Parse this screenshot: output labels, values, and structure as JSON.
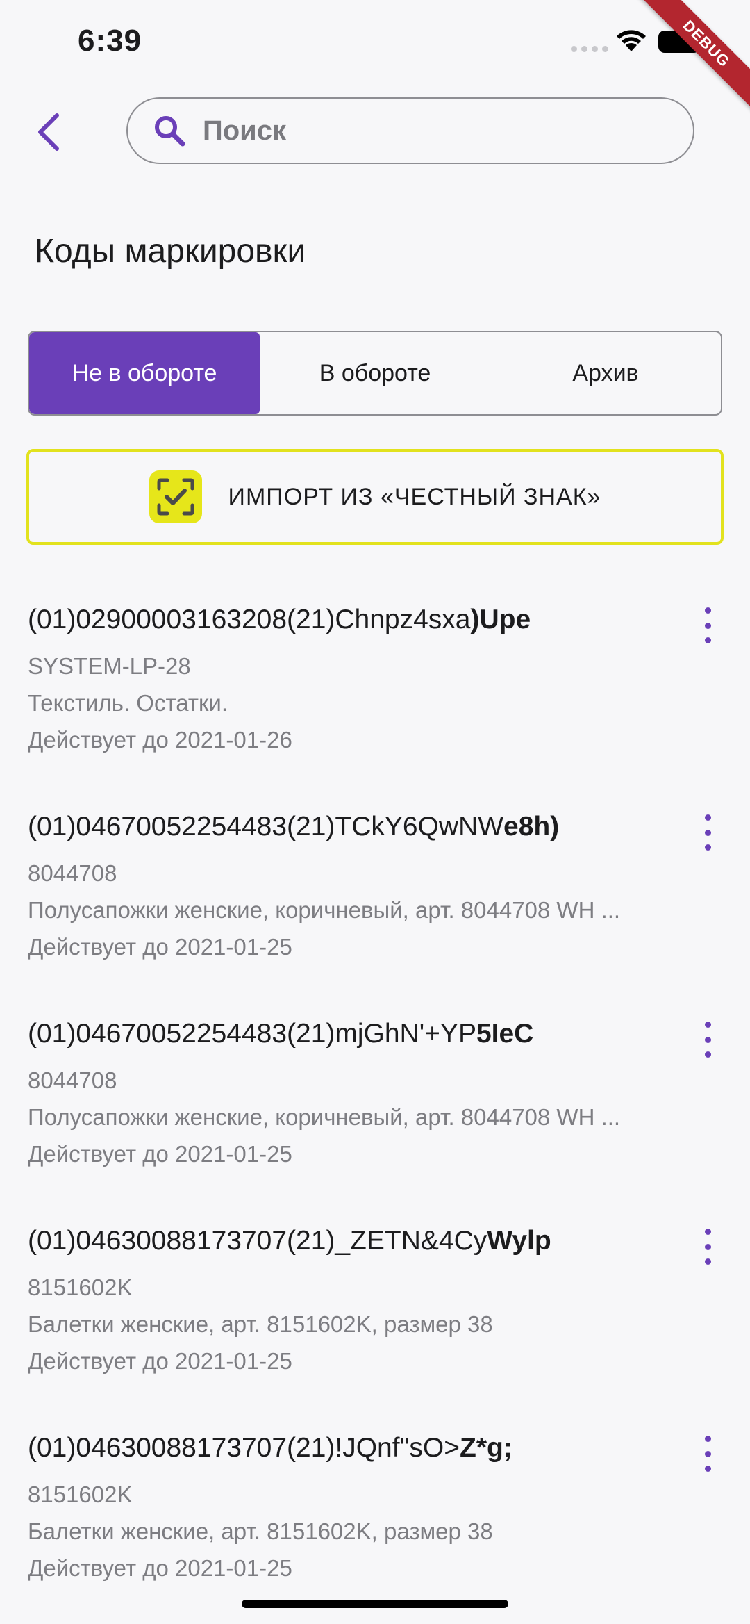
{
  "status_bar": {
    "time": "6:39"
  },
  "debug_banner": "DEBUG",
  "search": {
    "placeholder": "Поиск",
    "value": ""
  },
  "page_title": "Коды маркировки",
  "tabs": [
    {
      "label": "Не в обороте",
      "active": true
    },
    {
      "label": "В обороте",
      "active": false
    },
    {
      "label": "Архив",
      "active": false
    }
  ],
  "import_button": {
    "label": "ИМПОРТ ИЗ «ЧЕСТНЫЙ ЗНАК»",
    "icon": "honest-sign-check-icon"
  },
  "items": [
    {
      "code_prefix": "(01)02900003163208(21)Chnpz4sxa",
      "code_suffix": ")Upe",
      "sku": "SYSTEM-LP-28",
      "description": "Текстиль. Остатки.",
      "valid_until": "Действует до 2021-01-26"
    },
    {
      "code_prefix": "(01)04670052254483(21)TCkY6QwNW",
      "code_suffix": "e8h)",
      "sku": "8044708",
      "description": "Полусапожки женские, коричневый, арт. 8044708 WH ...",
      "valid_until": "Действует до 2021-01-25"
    },
    {
      "code_prefix": "(01)04670052254483(21)mjGhN'+YP",
      "code_suffix": "5IeC",
      "sku": "8044708",
      "description": "Полусапожки женские, коричневый, арт. 8044708 WH ...",
      "valid_until": "Действует до 2021-01-25"
    },
    {
      "code_prefix": "(01)04630088173707(21)_ZETN&4Cy",
      "code_suffix": "Wylp",
      "sku": "8151602K",
      "description": "Балетки женские, арт. 8151602K, размер 38",
      "valid_until": "Действует до 2021-01-25"
    },
    {
      "code_prefix": "(01)04630088173707(21)!JQnf\"sO>",
      "code_suffix": "Z*g;",
      "sku": "8151602K",
      "description": "Балетки женские, арт. 8151602K, размер 38",
      "valid_until": "Действует до 2021-01-25"
    }
  ],
  "colors": {
    "accent": "#6a3fb8",
    "import_border": "#e2e21e",
    "import_icon_bg": "#e6e61a",
    "secondary_text": "#7d7d82"
  }
}
